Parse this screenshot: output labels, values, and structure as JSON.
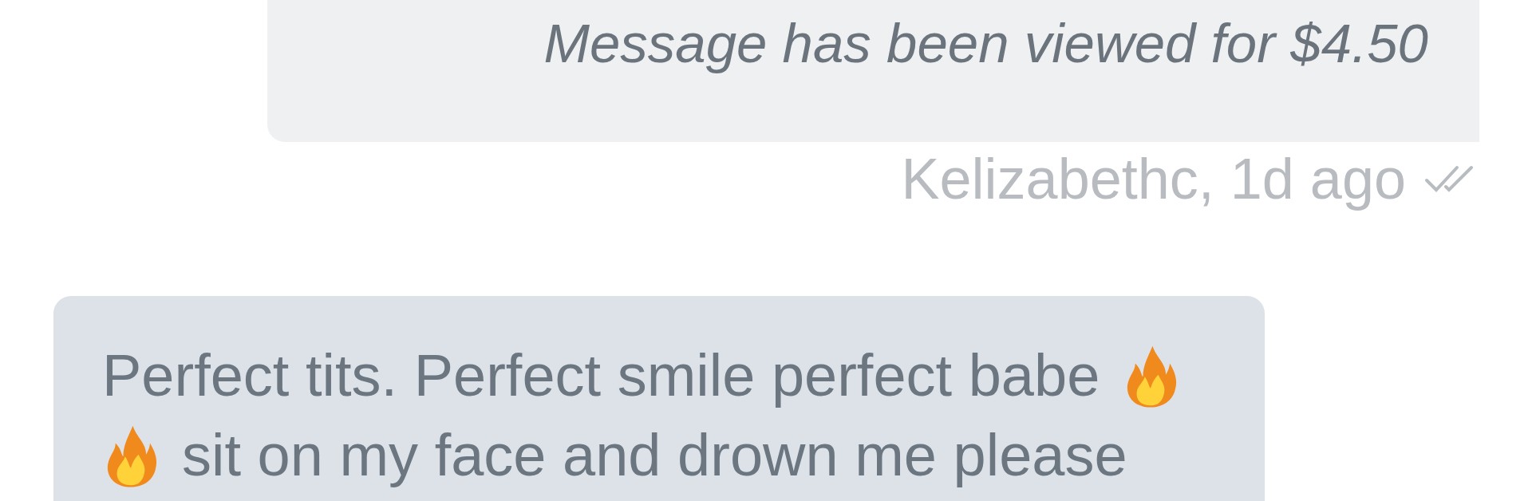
{
  "messages": [
    {
      "kind": "sent",
      "text": "Message has been viewed for $4.50",
      "meta": "Kelizabethc, 1d ago",
      "read": true
    },
    {
      "kind": "received",
      "lines": [
        [
          {
            "kind": "text",
            "text": "Perfect tits. Perfect smile perfect babe"
          },
          {
            "kind": "fire"
          }
        ],
        [
          {
            "kind": "fire"
          },
          {
            "kind": "text",
            "text": "sit on my face and drown me please"
          }
        ]
      ]
    }
  ]
}
